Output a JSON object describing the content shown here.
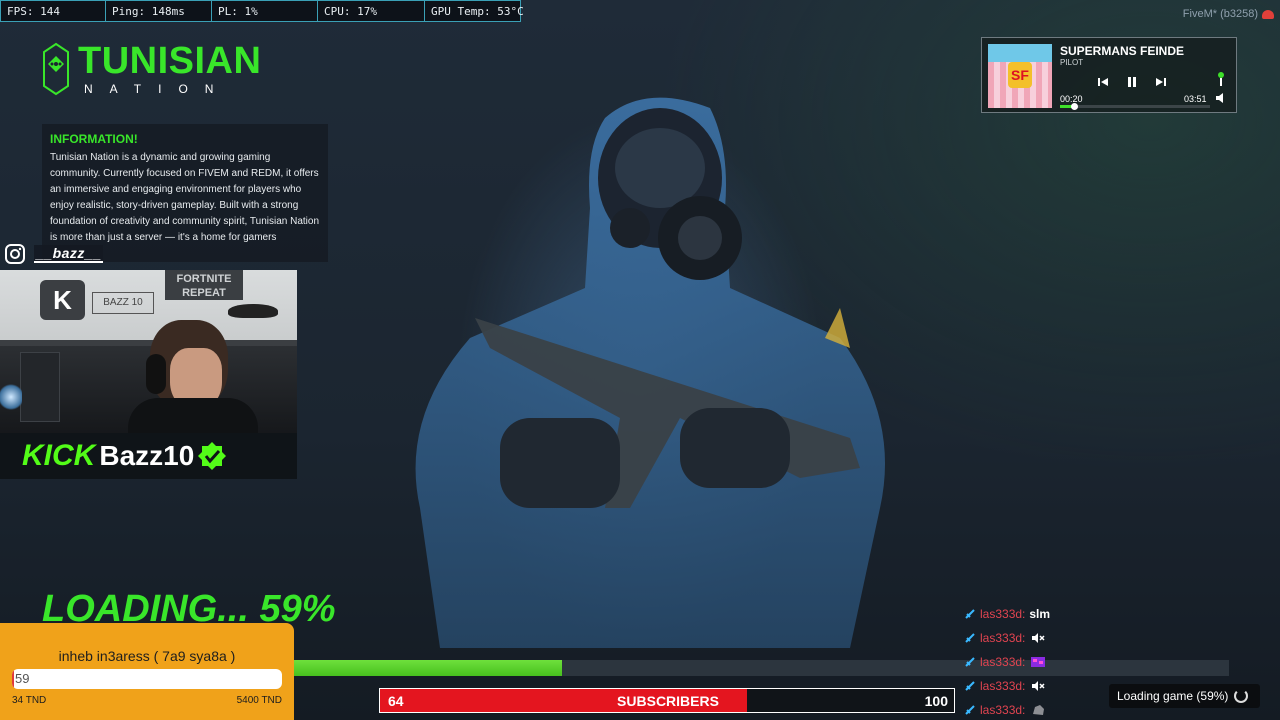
{
  "stats": {
    "fps": "FPS: 144",
    "ping": "Ping: 148ms",
    "pl": "PL: 1%",
    "cpu": "CPU: 17%",
    "gpu": "GPU Temp: 53°C"
  },
  "build": "FiveM* (b3258)",
  "server": {
    "title": "TUNISIAN",
    "subtitle": "NATION",
    "info_title": "INFORMATION!",
    "info_body": "Tunisian Nation is a dynamic and growing gaming community. Currently focused on FIVEM and REDM, it offers an immersive and engaging environment for players who enjoy realistic, story-driven gameplay. Built with a strong foundation of creativity and community spirit, Tunisian Nation is more than just a server — it's a home for gamers"
  },
  "instagram": {
    "handle": "__bazz__"
  },
  "kick": {
    "logo": "KICK",
    "name": "Bazz10"
  },
  "webcam": {
    "card_letter": "K",
    "sign_text": "BAZZ 10",
    "poster_text": "FORTNITE REPEAT"
  },
  "loading": {
    "text": "LOADING... 59%",
    "progress": 0.59
  },
  "donation_goal": {
    "title": "inheb in3aress ( 7a9 sya8a )",
    "current": "59",
    "min_label": "34 TND",
    "max_label": "5400 TND",
    "fill": 0.005
  },
  "subscribers": {
    "current": "64",
    "label": "SUBSCRIBERS",
    "goal": "100",
    "fill": 0.64
  },
  "player": {
    "title": "SUPERMANS FEINDE",
    "artist": "PILOT",
    "time_current": "00:20",
    "time_total": "03:51",
    "progress": 0.09,
    "cover_mark": "SF"
  },
  "chat": [
    {
      "user": "las333d:",
      "message": "slm",
      "emote": null
    },
    {
      "user": "las333d:",
      "message": "",
      "emote": "speaker-muted-emote"
    },
    {
      "user": "las333d:",
      "message": "",
      "emote": "pixel-emote"
    },
    {
      "user": "las333d:",
      "message": "",
      "emote": "speaker-muted-emote"
    },
    {
      "user": "las333d:",
      "message": "",
      "emote": "rock-emote"
    }
  ],
  "toast": {
    "text": "Loading game (59%)"
  },
  "colors": {
    "accent_green": "#39e62a",
    "kick_green": "#53fc18",
    "sub_red": "#e4151f",
    "goal_orange": "#f0a21a",
    "chat_user": "#e04450"
  }
}
